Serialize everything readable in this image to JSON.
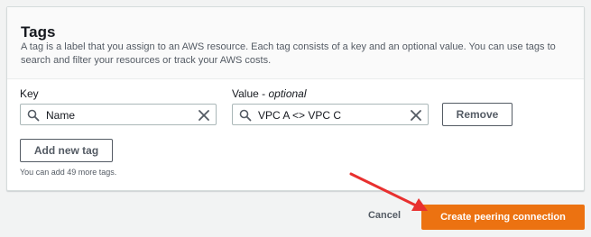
{
  "tags_panel": {
    "title": "Tags",
    "description": "A tag is a label that you assign to an AWS resource. Each tag consists of a key and an optional value. You can use tags to search and filter your resources or track your AWS costs.",
    "key_label": "Key",
    "value_label": "Value - ",
    "value_label_optional": "optional",
    "key_value": "Name",
    "value_value": "VPC A <> VPC C",
    "remove_label": "Remove",
    "add_tag_label": "Add new tag",
    "remaining_hint": "You can add 49 more tags."
  },
  "footer": {
    "cancel_label": "Cancel",
    "submit_label": "Create peering connection"
  },
  "colors": {
    "primary": "#ec7211",
    "annotation_arrow": "#e8302f"
  },
  "icons": [
    "search-icon",
    "clear-icon",
    "arrow-annotation"
  ]
}
